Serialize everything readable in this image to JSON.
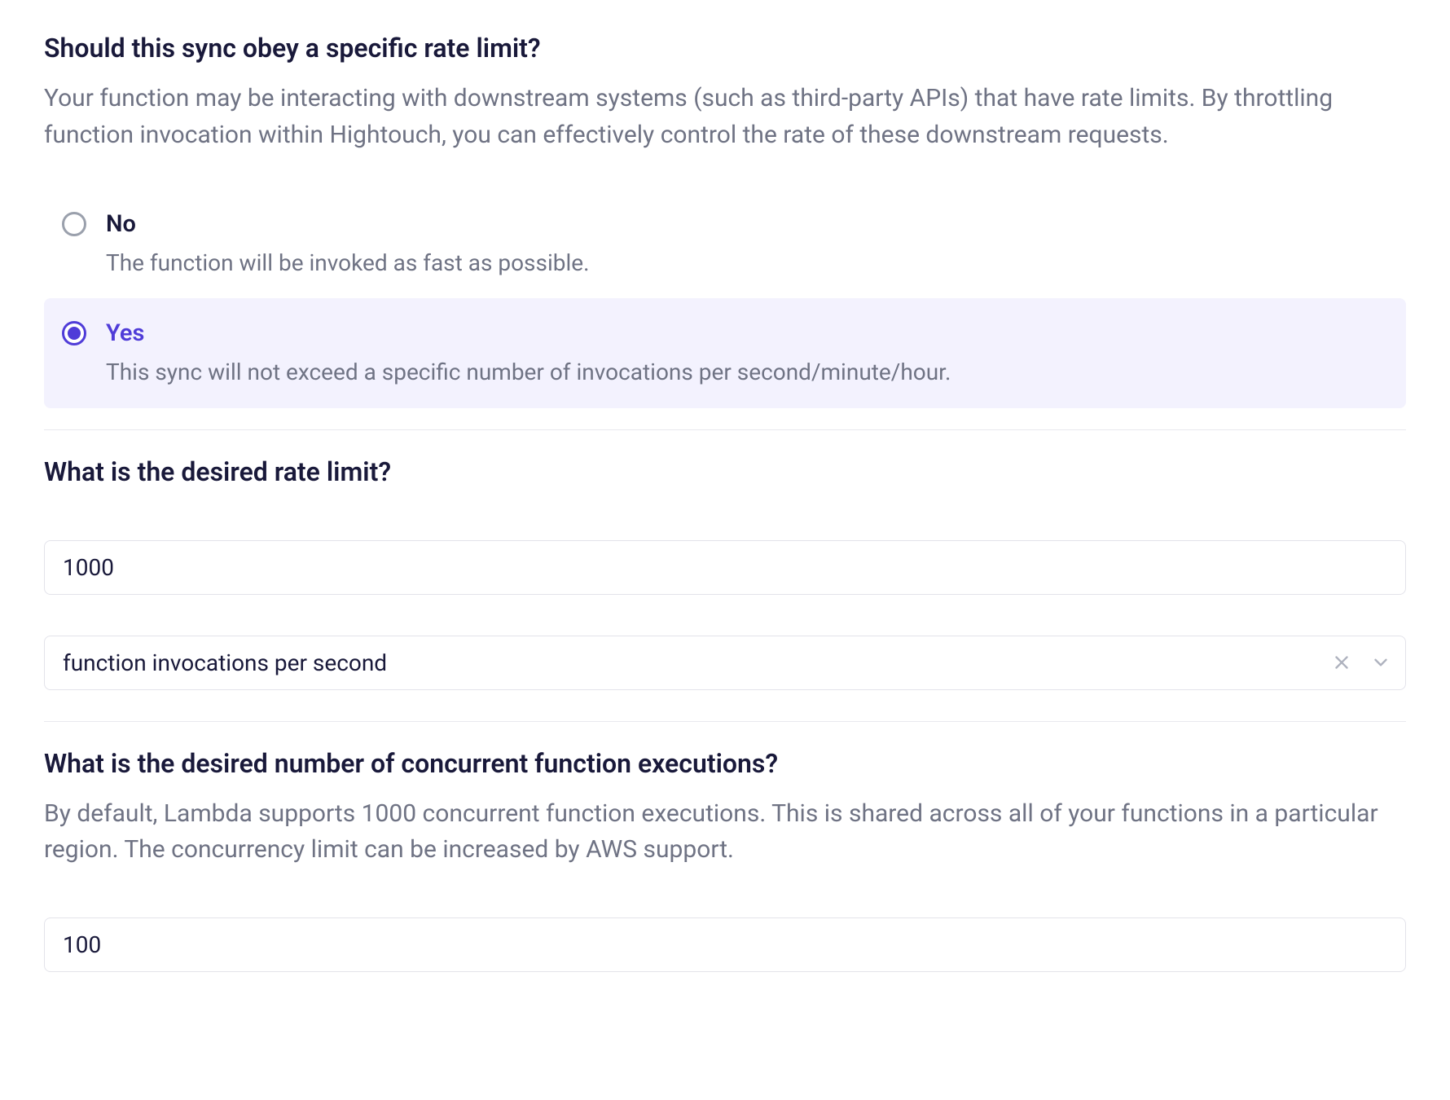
{
  "rate_limit_question": {
    "title": "Should this sync obey a specific rate limit?",
    "description": "Your function may be interacting with downstream systems (such as third-party APIs) that have rate limits. By throttling function invocation within Hightouch, you can effectively control the rate of these downstream requests.",
    "options": {
      "no": {
        "label": "No",
        "sub": "The function will be invoked as fast as possible."
      },
      "yes": {
        "label": "Yes",
        "sub": "This sync will not exceed a specific number of invocations per second/minute/hour."
      }
    },
    "selected": "yes"
  },
  "rate_limit_value": {
    "title": "What is the desired rate limit?",
    "value": "1000",
    "unit_selected": "function invocations per second"
  },
  "concurrency": {
    "title": "What is the desired number of concurrent function executions?",
    "description": "By default, Lambda supports 1000 concurrent function executions. This is shared across all of your functions in a particular region. The concurrency limit can be increased by AWS support.",
    "value": "100"
  }
}
